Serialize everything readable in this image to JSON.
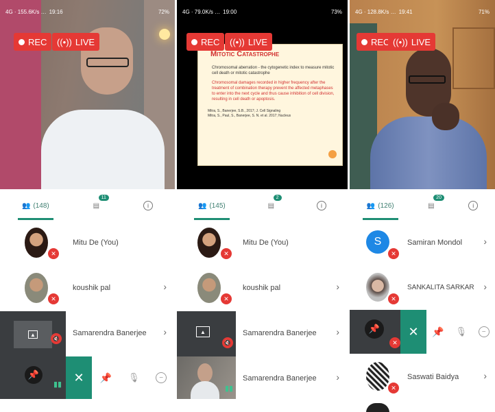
{
  "colors": {
    "accent": "#1e8e74",
    "rec": "#e53935"
  },
  "panels": [
    {
      "status": {
        "left": "4G · 155.6K/s …",
        "time": "19:16",
        "battery": "72%"
      },
      "rec_label": "REC",
      "live_label": "LIVE",
      "participants_count": "(148)",
      "chat_badge": "11",
      "rows": [
        {
          "name": "Mitu De (You)"
        },
        {
          "name": "koushik pal"
        },
        {
          "name": "Samarendra Banerjee"
        }
      ]
    },
    {
      "status": {
        "left": "4G · 79.0K/s …",
        "time": "19:00",
        "battery": "73%"
      },
      "rec_label": "REC",
      "live_label": "LIVE",
      "participants_count": "(145)",
      "chat_badge": "2",
      "slide": {
        "title": "Mitotic Catastrophe",
        "bullets": [
          "Chromosomal aberration - the cytogenetic index to measure mitotic cell death or mitotic catastrophe",
          "Chromosomal damages recorded in higher frequency after the treatment of combination therapy prevent the affected metaphases to enter into the next cycle and thus cause inhibition of cell division, resulting in cell death or apoptosis."
        ],
        "refs": [
          "Mitra, S., Banerjee, S.B., 2017; J. Cell Signaling",
          "Mitra, S., Paul, S., Banerjee, S. N. et al. 2017; Nucleus"
        ]
      },
      "rows": [
        {
          "name": "Mitu De (You)"
        },
        {
          "name": "koushik pal"
        },
        {
          "name": "Samarendra Banerjee"
        },
        {
          "name": "Samarendra Banerjee"
        }
      ]
    },
    {
      "status": {
        "left": "4G · 128.8K/s …",
        "time": "19:41",
        "battery": "71%"
      },
      "rec_label": "REC",
      "live_label": "LIVE",
      "participants_count": "(126)",
      "chat_badge": "20",
      "rows": [
        {
          "name": "Samiran Mondol",
          "initial": "S"
        },
        {
          "name": "SANKALITA SARKAR"
        },
        {
          "name": "Saswati Baidya"
        }
      ]
    }
  ]
}
